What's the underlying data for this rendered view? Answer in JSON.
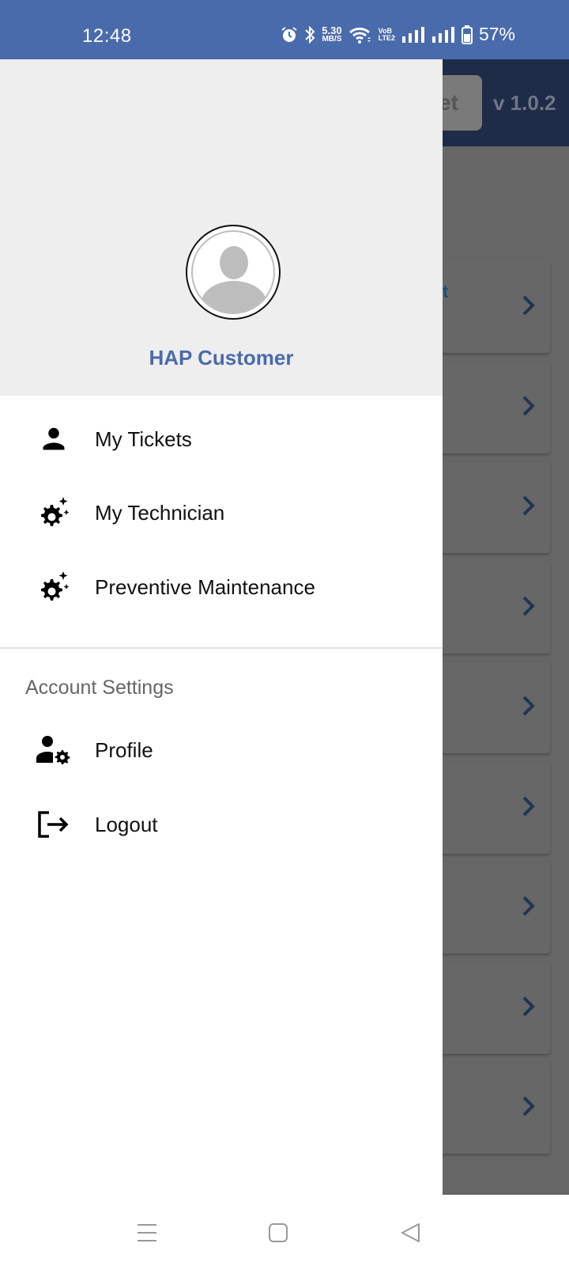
{
  "status_bar": {
    "time": "12:48",
    "network_speed_value": "5.30",
    "network_speed_unit": "MB/S",
    "volte_top": "VoB",
    "volte_bottom": "LTE2",
    "battery_percent": "57%",
    "icons": [
      "alarm-icon",
      "bluetooth-icon",
      "wifi-icon",
      "volte-icon",
      "signal-icon",
      "signal-icon",
      "battery-icon"
    ]
  },
  "background_app": {
    "header_button_fragment": "et",
    "version": "v 1.0.2",
    "card_title_fragment": "t",
    "card_count": 9,
    "accent_color": "#1f2c48"
  },
  "drawer": {
    "user_name": "HAP Customer",
    "avatar_icon": "user-placeholder-icon",
    "menu_items": [
      {
        "label": "My Tickets",
        "icon": "person-icon"
      },
      {
        "label": "My Technician",
        "icon": "gear-sparkle-icon"
      },
      {
        "label": "Preventive Maintenance",
        "icon": "gear-sparkle-icon"
      }
    ],
    "section_header": "Account Settings",
    "account_items": [
      {
        "label": "Profile",
        "icon": "person-gear-icon"
      },
      {
        "label": "Logout",
        "icon": "logout-icon"
      }
    ],
    "name_color": "#4a6bab"
  },
  "nav_bar": {
    "buttons": [
      "recents-icon",
      "home-icon",
      "back-icon"
    ]
  }
}
